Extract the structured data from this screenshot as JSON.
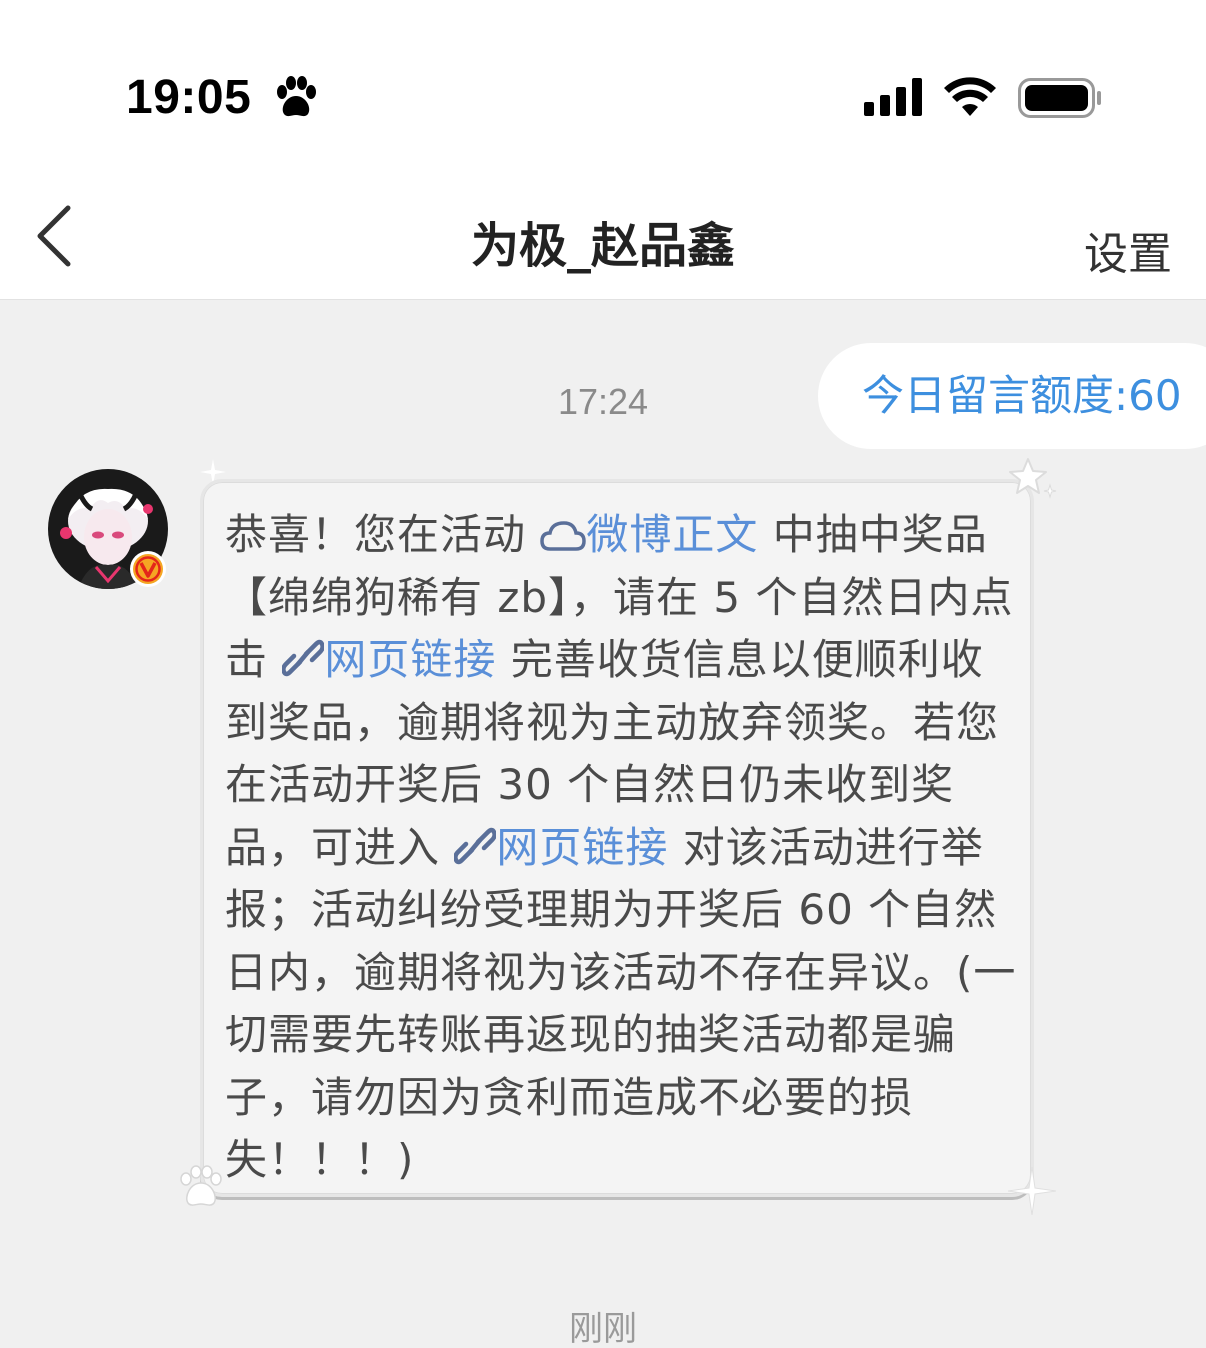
{
  "status_bar": {
    "time": "19:05",
    "paw_icon": "paw-icon",
    "signal_icon": "cellular-signal-icon",
    "wifi_icon": "wifi-icon",
    "battery_icon": "battery-icon"
  },
  "nav": {
    "back_icon": "chevron-left-icon",
    "title": "为极_赵品鑫",
    "settings_label": "设置"
  },
  "chat": {
    "quota": "今日留言额度:60",
    "timestamp": "17:24",
    "message": {
      "seg1": "恭喜！您在活动 ",
      "link1": "微博正文",
      "link1_icon": "weibo-cloud-icon",
      "seg2": " 中抽中奖品【绵绵狗稀有 zb】，请在 5 个自然日内点击 ",
      "link2": "网页链接",
      "link2_icon": "link-icon",
      "seg3": " 完善收货信息以便顺利收到奖品，逾期将视为主动放弃领奖。若您在活动开奖后 30 个自然日仍未收到奖品，可进入 ",
      "link3": "网页链接",
      "link3_icon": "link-icon",
      "seg4": " 对该活动进行举报；活动纠纷受理期为开奖后 60 个自然日内，逾期将视为该活动不存在异议。(一切需要先转账再返现的抽奖活动都是骗子，请勿因为贪利而造成不必要的损失！！！)"
    },
    "footer_time": "刚刚"
  },
  "colors": {
    "link": "#5a8fd8",
    "quota": "#3d8fdf",
    "verified_badge": "#f5a623"
  }
}
